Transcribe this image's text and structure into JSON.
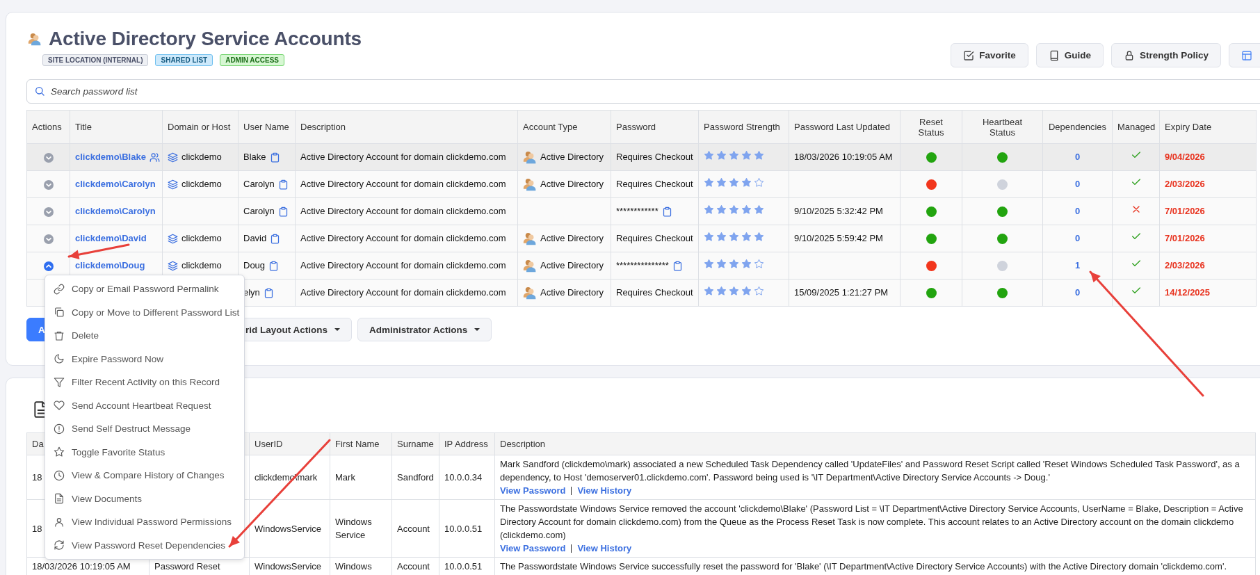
{
  "header": {
    "title": "Active Directory Service Accounts",
    "badges": [
      {
        "label": "SITE LOCATION (INTERNAL)",
        "kind": "neutral"
      },
      {
        "label": "SHARED LIST",
        "kind": "info"
      },
      {
        "label": "ADMIN ACCESS",
        "kind": "success"
      }
    ],
    "buttons": [
      {
        "label": "Favorite",
        "kind": "check"
      },
      {
        "label": "Guide",
        "kind": "book"
      },
      {
        "label": "Strength Policy",
        "kind": "lock"
      },
      {
        "kind": "layout"
      }
    ]
  },
  "search": {
    "placeholder": "Search password list"
  },
  "table": {
    "columns": [
      "Actions",
      "Title",
      "Domain or Host",
      "User Name",
      "Description",
      "Account Type",
      "Password",
      "Password Strength",
      "Password Last Updated",
      "Reset Status",
      "Heartbeat Status",
      "Dependencies",
      "Managed",
      "Expiry Date"
    ],
    "rows": [
      {
        "selected": true,
        "expanded": false,
        "title": "clickdemo\\Blake",
        "shared": true,
        "domain": "clickdemo",
        "user": "Blake",
        "description": "Active Directory Account for domain clickdemo.com",
        "account_type": "Active Directory",
        "password": "Requires Checkout",
        "password_copy": false,
        "stars": 5,
        "updated": "18/03/2026 10:19:05 AM",
        "reset_status": {
          "color": "#22a40f"
        },
        "heartbeat_status": {
          "color": "#22a40f"
        },
        "dependencies": "0",
        "managed": true,
        "expiry": "9/04/2026"
      },
      {
        "selected": false,
        "expanded": false,
        "title": "clickdemo\\Carolyn",
        "shared": false,
        "domain": "clickdemo",
        "user": "Carolyn",
        "description": "Active Directory Account for domain clickdemo.com",
        "account_type": "Active Directory",
        "password": "Requires Checkout",
        "password_copy": false,
        "stars": 4,
        "reset_status": {
          "color": "#f2361c"
        },
        "heartbeat_status": {
          "color": "#cfd3dc"
        },
        "dependencies": "0",
        "managed": true,
        "expiry": "2/03/2026"
      },
      {
        "selected": false,
        "expanded": false,
        "title": "clickdemo\\Carolyn",
        "shared": false,
        "user": "Carolyn",
        "description": "Active Directory Account for domain clickdemo.com",
        "password": "************",
        "password_copy": true,
        "stars": 5,
        "updated": "9/10/2025 5:32:42 PM",
        "reset_status": {
          "color": "#22a40f"
        },
        "heartbeat_status": {
          "color": "#22a40f"
        },
        "dependencies": "0",
        "managed": false,
        "expiry": "7/01/2026"
      },
      {
        "selected": false,
        "expanded": false,
        "title": "clickdemo\\David",
        "shared": false,
        "domain": "clickdemo",
        "user": "David",
        "description": "Active Directory Account for domain clickdemo.com",
        "account_type": "Active Directory",
        "password": "Requires Checkout",
        "password_copy": false,
        "stars": 5,
        "updated": "9/10/2025 5:59:42 PM",
        "reset_status": {
          "color": "#22a40f"
        },
        "heartbeat_status": {
          "color": "#22a40f"
        },
        "dependencies": "0",
        "managed": true,
        "expiry": "7/01/2026"
      },
      {
        "selected": false,
        "expanded": true,
        "title": "clickdemo\\Doug",
        "shared": false,
        "domain": "clickdemo",
        "user": "Doug",
        "description": "Active Directory Account for domain clickdemo.com",
        "account_type": "Active Directory",
        "password": "***************",
        "password_copy": true,
        "stars": 4,
        "reset_status": {
          "color": "#f2361c"
        },
        "heartbeat_status": {
          "color": "#cfd3dc"
        },
        "dependencies": "1",
        "managed": true,
        "expiry": "2/03/2026"
      },
      {
        "selected": false,
        "user": "elyn",
        "description": "Active Directory Account for domain clickdemo.com",
        "account_type": "Active Directory",
        "password": "Requires Checkout",
        "password_copy": false,
        "stars": 4,
        "updated": "15/09/2025 1:21:27 PM",
        "reset_status": {
          "color": "#22a40f"
        },
        "heartbeat_status": {
          "color": "#22a40f"
        },
        "dependencies": "0",
        "managed": true,
        "expiry": "14/12/2025"
      }
    ]
  },
  "actions": [
    {
      "label": "A",
      "kind": "primary"
    },
    {
      "label": "rid Layout Actions",
      "kind": "dropdown"
    },
    {
      "label": "Administrator Actions",
      "kind": "dropdown"
    }
  ],
  "context_menu": {
    "items": [
      "Copy or Email Password Permalink",
      "Copy or Move to Different Password List",
      "Delete",
      "Expire Password Now",
      "Filter Recent Activity on this Record",
      "Send Account Heartbeat Request",
      "Send Self Destruct Message",
      "Toggle Favorite Status",
      "View & Compare History of Changes",
      "View Documents",
      "View Individual Password Permissions",
      "View Password Reset Dependencies"
    ]
  },
  "activity_table": {
    "columns": [
      "Da",
      "UserID",
      "First Name",
      "Surname",
      "IP Address",
      "Description"
    ],
    "rows": [
      {
        "date": "18",
        "user_id": "clickdemo\\mark",
        "first_name": "Mark",
        "surname": "Sandford",
        "ip": "10.0.0.34",
        "description": "Mark Sandford (clickdemo\\mark) associated a new Scheduled Task Dependency called 'UpdateFiles' and Password Reset Script called 'Reset Windows Scheduled Task Password', as a dependency, to Host 'demoserver01.clickdemo.com'. Password being used is '\\IT Department\\Active Directory Service Accounts -> Doug.'",
        "links": [
          "View Password",
          "View History"
        ]
      },
      {
        "date": "18",
        "user_id": "WindowsService",
        "first_name": "Windows Service",
        "surname": "Account",
        "ip": "10.0.0.51",
        "description": "The Passwordstate Windows Service removed the account 'clickdemo\\Blake' (Password List = \\IT Department\\Active Directory Service Accounts, UserName = Blake, Description = Active Directory Account for domain clickdemo.com) from the Queue as the Process Reset Task is now complete. This account relates to an Active Directory account on the domain clickdemo (clickdemo.com)",
        "links": [
          "View Password",
          "View History"
        ]
      },
      {
        "date": "18/03/2026 10:19:05 AM",
        "column_2": "Password Reset",
        "user_id": "WindowsService",
        "first_name": "Windows",
        "surname": "Account",
        "ip": "10.0.0.51",
        "description": "The Passwordstate Windows Service successfully reset the password for 'Blake' (\\IT Department\\Active Directory Service Accounts) with the Active Directory domain 'clickdemo.com'."
      }
    ]
  }
}
